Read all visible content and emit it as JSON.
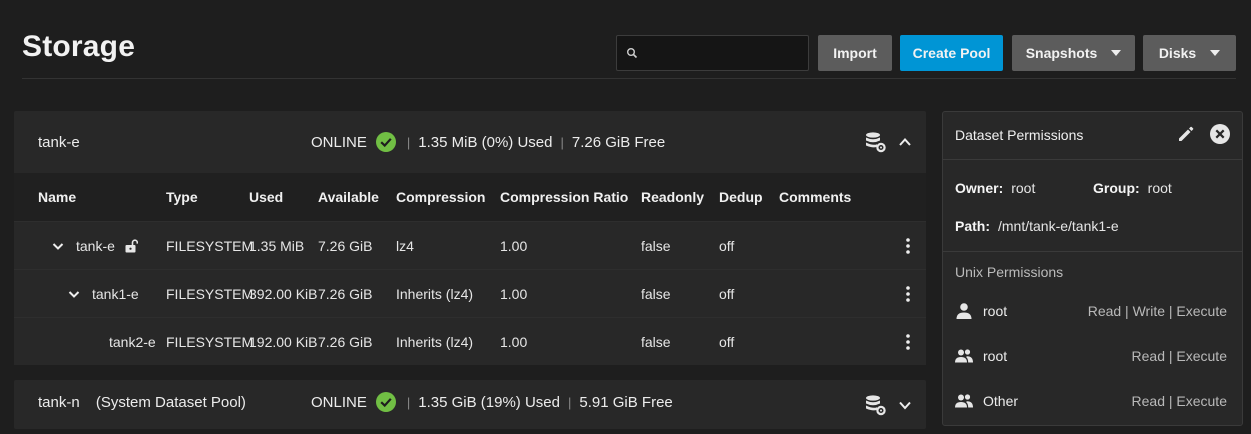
{
  "page": {
    "title": "Storage"
  },
  "toolbar": {
    "search_placeholder": "",
    "import_label": "Import",
    "create_pool_label": "Create Pool",
    "snapshots_label": "Snapshots",
    "disks_label": "Disks"
  },
  "pools": [
    {
      "name": "tank-e",
      "suffix": "",
      "status": "ONLINE",
      "used": "1.35 MiB (0%) Used",
      "free": "7.26 GiB Free",
      "expanded": true
    },
    {
      "name": "tank-n",
      "suffix": "(System Dataset Pool)",
      "status": "ONLINE",
      "used": "1.35 GiB (19%) Used",
      "free": "5.91 GiB Free",
      "expanded": false
    }
  ],
  "dataset_table": {
    "headers": [
      "Name",
      "Type",
      "Used",
      "Available",
      "Compression",
      "Compression Ratio",
      "Readonly",
      "Dedup",
      "Comments"
    ],
    "rows": [
      {
        "name": "tank-e",
        "type": "FILESYSTEM",
        "used": "1.35 MiB",
        "available": "7.26 GiB",
        "compression": "lz4",
        "ratio": "1.00",
        "readonly": "false",
        "dedup": "off",
        "comments": ""
      },
      {
        "name": "tank1-e",
        "type": "FILESYSTEM",
        "used": "392.00 KiB",
        "available": "7.26 GiB",
        "compression": "Inherits (lz4)",
        "ratio": "1.00",
        "readonly": "false",
        "dedup": "off",
        "comments": ""
      },
      {
        "name": "tank2-e",
        "type": "FILESYSTEM",
        "used": "192.00 KiB",
        "available": "7.26 GiB",
        "compression": "Inherits (lz4)",
        "ratio": "1.00",
        "readonly": "false",
        "dedup": "off",
        "comments": ""
      }
    ]
  },
  "permissions": {
    "title": "Dataset Permissions",
    "owner_label": "Owner:",
    "owner": "root",
    "group_label": "Group:",
    "group": "root",
    "path_label": "Path:",
    "path": "/mnt/tank-e/tank1-e",
    "unix_title": "Unix Permissions",
    "entries": [
      {
        "who": "root",
        "rights": "Read | Write | Execute",
        "icon": "user-icon"
      },
      {
        "who": "root",
        "rights": "Read | Execute",
        "icon": "group-icon"
      },
      {
        "who": "Other",
        "rights": "Read | Execute",
        "icon": "group-icon"
      }
    ]
  },
  "colors": {
    "background": "#1e1e1e",
    "card": "#282828",
    "accent": "#0095d5",
    "ok": "#71bf44",
    "button": "#5c5c5c"
  }
}
